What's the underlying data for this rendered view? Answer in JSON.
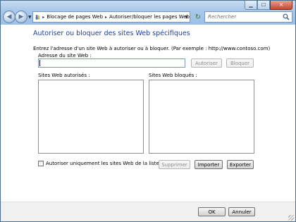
{
  "window": {
    "controls": {
      "minimize_icon": "minimize-icon",
      "maximize_icon": "maximize-icon",
      "close_icon": "close-icon"
    }
  },
  "address_bar": {
    "crumbs": [
      "Blocage de pages Web",
      "Autoriser/bloquer les pages Web"
    ],
    "separator": "▸"
  },
  "search": {
    "placeholder": "Rechercher"
  },
  "page": {
    "title": "Autoriser ou bloquer des sites Web spécifiques",
    "instruction": "Entrez l'adresse d'un site Web à autoriser ou à bloquer.  (Par exemple : http://www.contoso.com)",
    "address_label": "Adresse du site Web :",
    "address_value": "",
    "allow_button": "Autoriser",
    "block_button": "Bloquer",
    "allowed_label": "Sites Web autorisés :",
    "blocked_label": "Sites Web bloqués :",
    "allowed_sites": [],
    "blocked_sites": [],
    "only_allowed_label": "Autoriser uniquement les sites Web de la liste verte",
    "only_allowed_checked": false,
    "remove_button": "Supprimer",
    "import_button": "Importer",
    "export_button": "Exporter"
  },
  "footer": {
    "ok_button": "OK",
    "cancel_button": "Annuler"
  },
  "colors": {
    "title": "#1f3f9b",
    "chrome": "#a9c8ea",
    "close": "#c5472f"
  }
}
